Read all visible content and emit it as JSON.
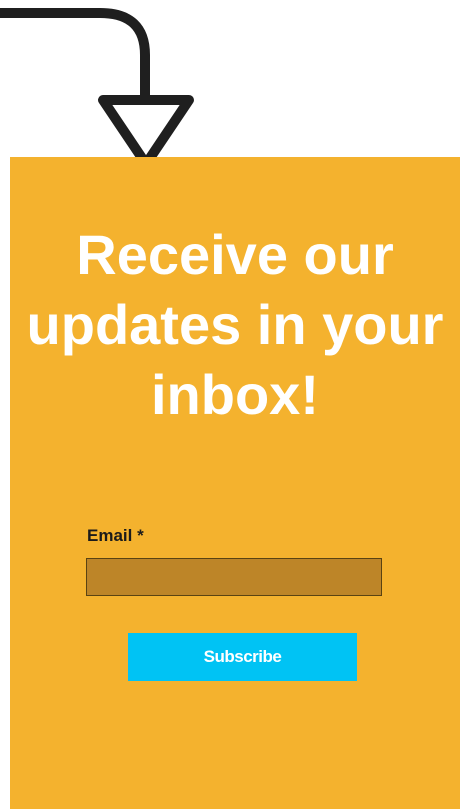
{
  "colors": {
    "panel_background": "#f4b22e",
    "input_background": "#bd8528",
    "button_background": "#00c3f4",
    "arrow_stroke": "#1f1f1f",
    "headline_text": "#ffffff"
  },
  "decoration": {
    "arrow_icon": "curved-down-arrow-icon"
  },
  "signup": {
    "headline": "Receive our updates in your inbox!",
    "email_label": "Email *",
    "email_value": "",
    "email_placeholder": "",
    "subscribe_label": "Subscribe"
  }
}
